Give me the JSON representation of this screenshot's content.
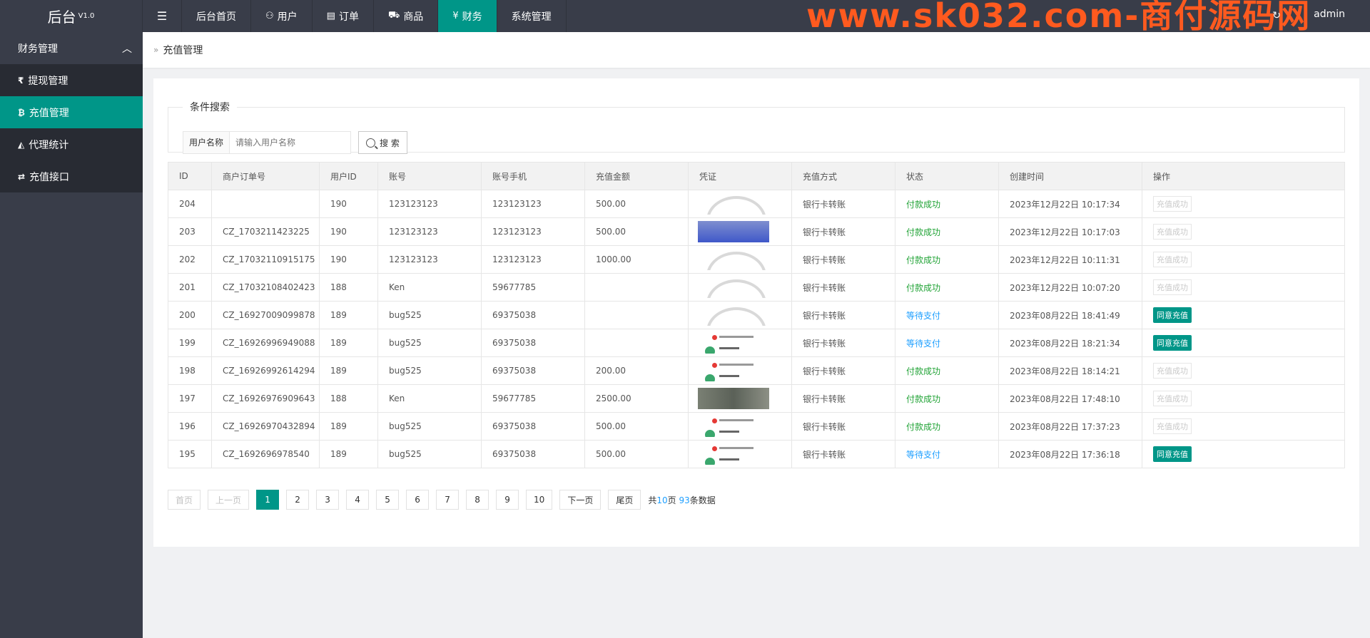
{
  "header": {
    "logo": "后台",
    "version": "V1.0",
    "nav": [
      {
        "label": "后台首页",
        "icon": ""
      },
      {
        "label": "用户",
        "icon": "user-icon"
      },
      {
        "label": "订单",
        "icon": "order-icon"
      },
      {
        "label": "商品",
        "icon": "cart-icon"
      },
      {
        "label": "财务",
        "icon": "yen-icon",
        "active": true
      },
      {
        "label": "系统管理",
        "icon": ""
      }
    ],
    "watermark": "www.sk032.com-商付源码网",
    "user": "admin"
  },
  "sidebar": {
    "group": "财务管理",
    "items": [
      {
        "label": "提现管理",
        "icon": "rupee-icon"
      },
      {
        "label": "充值管理",
        "icon": "bitcoin-icon",
        "active": true
      },
      {
        "label": "代理统计",
        "icon": "area-chart-icon"
      },
      {
        "label": "充值接口",
        "icon": "exchange-icon"
      }
    ]
  },
  "breadcrumb": "充值管理",
  "search": {
    "legend": "条件搜索",
    "label": "用户名称",
    "placeholder": "请输入用户名称",
    "button": "搜 索"
  },
  "table": {
    "columns": [
      "ID",
      "商户订单号",
      "用户ID",
      "账号",
      "账号手机",
      "充值金额",
      "凭证",
      "充值方式",
      "状态",
      "创建时间",
      "操作"
    ],
    "rows": [
      {
        "id": "204",
        "order": "",
        "uid": "190",
        "account": "123123123",
        "phone": "123123123",
        "amount": "500.00",
        "voucher": "arc",
        "method": "银行卡转账",
        "status": "付款成功",
        "status_type": "ok",
        "time": "2023年12月22日 10:17:34",
        "op": "充值成功",
        "op_type": "disabled"
      },
      {
        "id": "203",
        "order": "CZ_1703211423225",
        "uid": "190",
        "account": "123123123",
        "phone": "123123123",
        "amount": "500.00",
        "voucher": "blue",
        "method": "银行卡转账",
        "status": "付款成功",
        "status_type": "ok",
        "time": "2023年12月22日 10:17:03",
        "op": "充值成功",
        "op_type": "disabled"
      },
      {
        "id": "202",
        "order": "CZ_17032110915175",
        "uid": "190",
        "account": "123123123",
        "phone": "123123123",
        "amount": "1000.00",
        "voucher": "arc",
        "method": "银行卡转账",
        "status": "付款成功",
        "status_type": "ok",
        "time": "2023年12月22日 10:11:31",
        "op": "充值成功",
        "op_type": "disabled"
      },
      {
        "id": "201",
        "order": "CZ_17032108402423",
        "uid": "188",
        "account": "Ken",
        "phone": "59677785",
        "amount": "",
        "voucher": "arc",
        "method": "银行卡转账",
        "status": "付款成功",
        "status_type": "ok",
        "time": "2023年12月22日 10:07:20",
        "op": "充值成功",
        "op_type": "disabled"
      },
      {
        "id": "200",
        "order": "CZ_16927009099878",
        "uid": "189",
        "account": "bug525",
        "phone": "69375038",
        "amount": "",
        "voucher": "arc",
        "method": "银行卡转账",
        "status": "等待支付",
        "status_type": "wait",
        "time": "2023年08月22日 18:41:49",
        "op": "同意充值",
        "op_type": "active"
      },
      {
        "id": "199",
        "order": "CZ_16926996949088",
        "uid": "189",
        "account": "bug525",
        "phone": "69375038",
        "amount": "",
        "voucher": "receipt",
        "method": "银行卡转账",
        "status": "等待支付",
        "status_type": "wait",
        "time": "2023年08月22日 18:21:34",
        "op": "同意充值",
        "op_type": "active"
      },
      {
        "id": "198",
        "order": "CZ_16926992614294",
        "uid": "189",
        "account": "bug525",
        "phone": "69375038",
        "amount": "200.00",
        "voucher": "receipt",
        "method": "银行卡转账",
        "status": "付款成功",
        "status_type": "ok",
        "time": "2023年08月22日 18:14:21",
        "op": "充值成功",
        "op_type": "disabled"
      },
      {
        "id": "197",
        "order": "CZ_16926976909643",
        "uid": "188",
        "account": "Ken",
        "phone": "59677785",
        "amount": "2500.00",
        "voucher": "phone",
        "method": "银行卡转账",
        "status": "付款成功",
        "status_type": "ok",
        "time": "2023年08月22日 17:48:10",
        "op": "充值成功",
        "op_type": "disabled"
      },
      {
        "id": "196",
        "order": "CZ_16926970432894",
        "uid": "189",
        "account": "bug525",
        "phone": "69375038",
        "amount": "500.00",
        "voucher": "receipt",
        "method": "银行卡转账",
        "status": "付款成功",
        "status_type": "ok",
        "time": "2023年08月22日 17:37:23",
        "op": "充值成功",
        "op_type": "disabled"
      },
      {
        "id": "195",
        "order": "CZ_1692696978540",
        "uid": "189",
        "account": "bug525",
        "phone": "69375038",
        "amount": "500.00",
        "voucher": "receipt",
        "method": "银行卡转账",
        "status": "等待支付",
        "status_type": "wait",
        "time": "2023年08月22日 17:36:18",
        "op": "同意充值",
        "op_type": "active"
      }
    ]
  },
  "pager": {
    "first": "首页",
    "prev": "上一页",
    "pages": [
      "1",
      "2",
      "3",
      "4",
      "5",
      "6",
      "7",
      "8",
      "9",
      "10"
    ],
    "current": "1",
    "next": "下一页",
    "last": "尾页",
    "info_prefix": "共",
    "total_pages": "10",
    "info_mid": "页",
    "total_records": "93",
    "info_suffix": "条数据"
  },
  "colors": {
    "accent": "#009688",
    "nav_bg": "#393d49",
    "success": "#21a336",
    "waiting": "#1e9fff"
  }
}
